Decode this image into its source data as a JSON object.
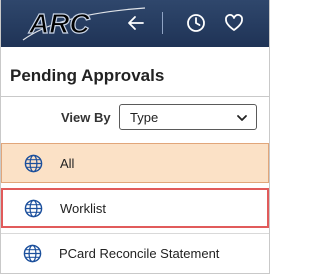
{
  "app": {
    "logo_text": "ARC"
  },
  "toolbar": {
    "icons": [
      "back-arrow-icon",
      "history-clock-icon",
      "favorites-heart-icon"
    ]
  },
  "page": {
    "title": "Pending Approvals"
  },
  "filter": {
    "label": "View By",
    "selected": "Type"
  },
  "list": {
    "items": [
      {
        "label": "All",
        "icon": "globe-icon",
        "state": "selected"
      },
      {
        "label": "Worklist",
        "icon": "globe-icon",
        "state": "focused"
      },
      {
        "label": "PCard Reconcile Statement",
        "icon": "globe-icon",
        "state": "normal"
      }
    ]
  },
  "colors": {
    "header_bg": "#243a5e",
    "selected_row": "#fbe1c6",
    "focus_outline": "#e15b5b",
    "globe": "#1b4f9c"
  }
}
